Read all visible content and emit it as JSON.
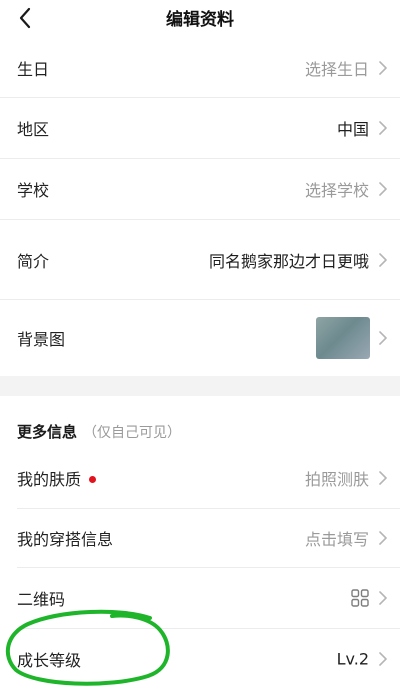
{
  "header": {
    "title": "编辑资料",
    "back_icon": "chevron-left-icon"
  },
  "rows": [
    {
      "label": "生日",
      "value": "选择生日",
      "value_style": "placeholder"
    },
    {
      "label": "地区",
      "value": "中国",
      "value_style": "filled"
    },
    {
      "label": "学校",
      "value": "选择学校",
      "value_style": "placeholder"
    },
    {
      "label": "简介",
      "value": "同名鹅家那边才日更哦",
      "value_style": "filled"
    },
    {
      "label": "背景图",
      "value_type": "image-thumbnail"
    }
  ],
  "more_info": {
    "title": "更多信息",
    "note": "（仅自己可见）",
    "rows": [
      {
        "label": "我的肤质",
        "badge": "red-dot",
        "value": "拍照测肤"
      },
      {
        "label": "我的穿搭信息",
        "value": "点击填写"
      },
      {
        "label": "二维码",
        "value_icon": "qr-code-icon"
      },
      {
        "label": "成长等级",
        "value": "Lv.2"
      }
    ]
  },
  "colors": {
    "placeholder_text": "#9a9a9a",
    "value_text": "#1f1f1f",
    "badge_red": "#e0131f",
    "annotation_green": "#1fb52b",
    "section_gap": "#f3f3f3"
  }
}
